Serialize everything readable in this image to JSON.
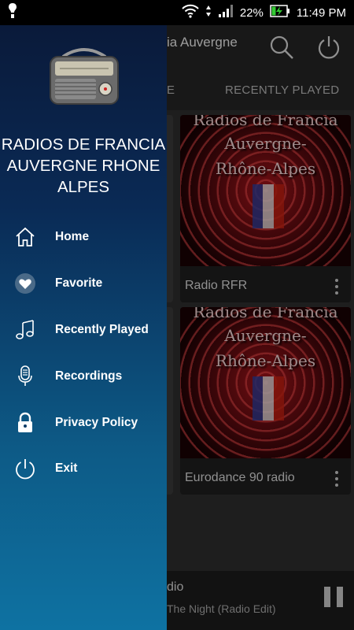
{
  "status_bar": {
    "battery_percent": "22%",
    "time": "11:49 PM",
    "icons": [
      "notification-icon",
      "wifi-icon",
      "data-arrows-icon",
      "signal-icon",
      "battery-charging-icon"
    ]
  },
  "app": {
    "title_partial": "ia Auvergne",
    "tabs": [
      {
        "label": "E"
      },
      {
        "label": "RECENTLY PLAYED"
      }
    ],
    "cards": [
      {
        "name": "Radio RFR",
        "art_lines": [
          "Radios de Francia",
          "Auvergne-",
          "Rhône-Alpes"
        ]
      },
      {
        "name": "Eurodance 90 radio",
        "art_lines": [
          "Radios de Francia",
          "Auvergne-",
          "Rhône-Alpes"
        ]
      }
    ],
    "player": {
      "title_partial": "dio",
      "subtitle_partial": "The Night (Radio Edit)"
    }
  },
  "drawer": {
    "title": "RADIOS DE FRANCIA AUVERGNE RHONE ALPES",
    "items": [
      {
        "label": "Home",
        "icon": "home-icon"
      },
      {
        "label": "Favorite",
        "icon": "heart-icon"
      },
      {
        "label": "Recently Played",
        "icon": "music-note-icon"
      },
      {
        "label": "Recordings",
        "icon": "microphone-icon"
      },
      {
        "label": "Privacy Policy",
        "icon": "lock-icon"
      },
      {
        "label": "Exit",
        "icon": "power-icon"
      }
    ]
  },
  "colors": {
    "drawer_top": "#0a1a3a",
    "drawer_bottom": "#0e72a2",
    "app_bg": "#2e2e2e",
    "toolbar_bg": "#262626"
  }
}
